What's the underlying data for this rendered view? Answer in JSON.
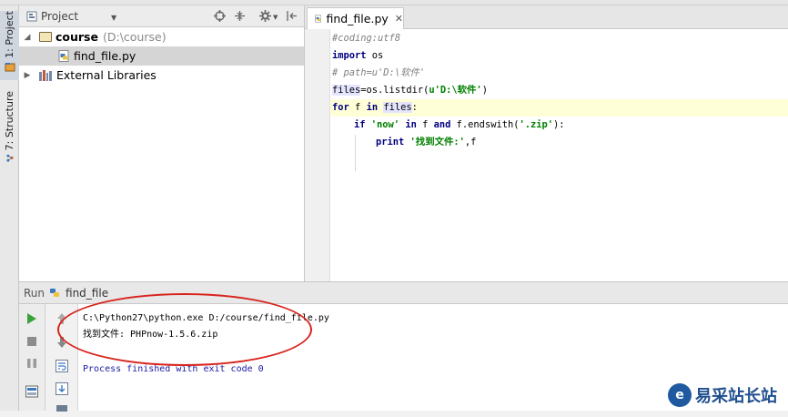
{
  "sidebar": {
    "project_tab": "1: Project",
    "structure_tab": "7: Structure"
  },
  "project_panel": {
    "title": "Project",
    "tree": {
      "root_name": "course",
      "root_path": "(D:\\course)",
      "file": "find_file.py",
      "libraries": "External Libraries"
    }
  },
  "editor": {
    "tab_label": "find_file.py",
    "code": {
      "line1": "#coding:utf8",
      "line2_kw": "import",
      "line2_rest": " os",
      "line3": "# path=u'D:\\软件'",
      "line4_var": "files",
      "line4_rest": "=os.listdir(",
      "line4_str": "u'D:\\软件'",
      "line4_end": ")",
      "line5_kw1": "for",
      "line5_mid": " f ",
      "line5_kw2": "in",
      "line5_sp": " ",
      "line5_var": "files",
      "line5_end": ":",
      "line6_kw1": "if",
      "line6_sp": " ",
      "line6_str": "'now'",
      "line6_sp2": " ",
      "line6_kw2": "in",
      "line6_mid": " f ",
      "line6_kw3": "and",
      "line6_call": " f.endswith(",
      "line6_str2": "'.zip'",
      "line6_end": "):",
      "line7_kw": "print",
      "line7_sp": " ",
      "line7_str": "'找到文件:'",
      "line7_end": ",f"
    }
  },
  "run_panel": {
    "label": "Run",
    "config": "find_file",
    "output": {
      "command": "C:\\Python27\\python.exe D:/course/find_file.py",
      "found": "找到文件: PHPnow-1.5.6.zip",
      "exit": "Process finished with exit code 0"
    }
  },
  "watermark": {
    "text": "易采站长站"
  },
  "colors": {
    "keyword": "#000080",
    "string": "#008000",
    "comment": "#808080",
    "annotation": "#d8231c"
  }
}
